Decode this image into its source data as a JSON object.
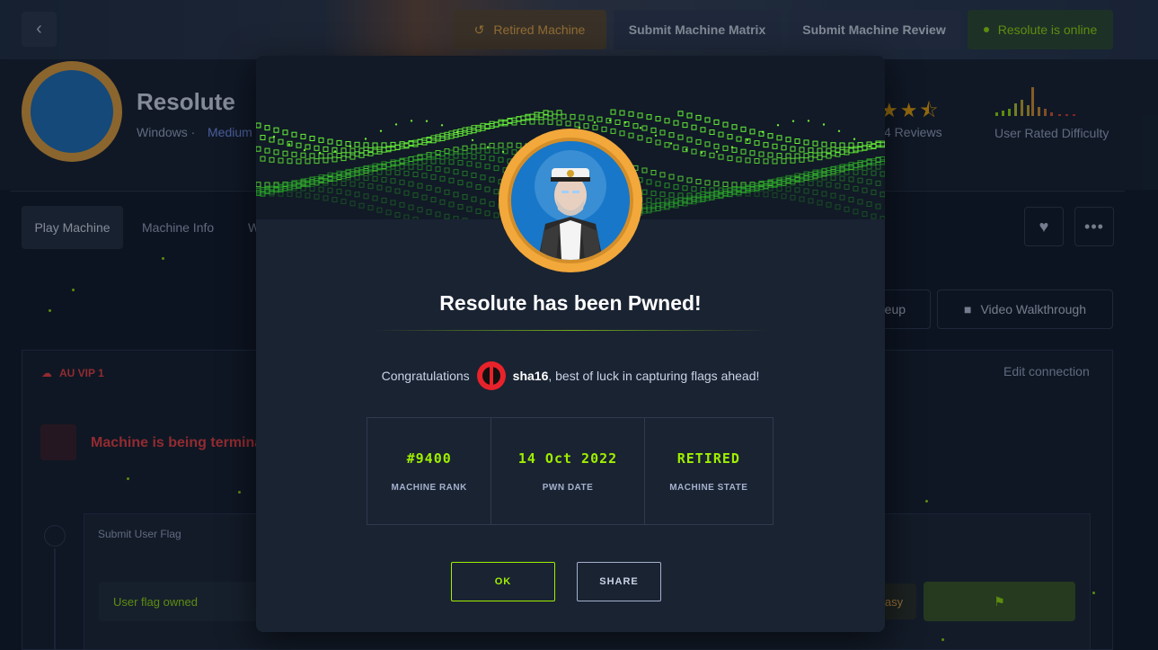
{
  "topbar": {
    "retired_label": "Retired Machine",
    "matrix_label": "Submit Machine Matrix",
    "review_label": "Submit Machine Review",
    "online_label": "Resolute is online"
  },
  "machine": {
    "name": "Resolute",
    "os": "Windows ·",
    "difficulty": "Medium",
    "reviews": "4 Reviews",
    "user_rated_difficulty": "User Rated Difficulty",
    "rating_stars": 4.5
  },
  "tabs": [
    {
      "label": "Play Machine"
    },
    {
      "label": "Machine Info"
    },
    {
      "label": "W"
    }
  ],
  "actions": {
    "writeup_label": "riteup",
    "video_label": "Video Walkthrough"
  },
  "panel": {
    "vip_label": "AU VIP 1",
    "edit_connection": "Edit connection",
    "terminating_text": "Machine is being termina",
    "submit_user_flag": "Submit User Flag",
    "user_flag_owned": "User flag owned",
    "easy_chip": "asy"
  },
  "modal": {
    "title": "Resolute has been Pwned!",
    "congrats_prefix": "Congratulations",
    "username": "sha16",
    "congrats_suffix": ", best of luck in capturing flags ahead!",
    "stats": [
      {
        "value": "#9400",
        "label": "MACHINE RANK"
      },
      {
        "value": "14 Oct 2022",
        "label": "PWN DATE"
      },
      {
        "value": "RETIRED",
        "label": "MACHINE STATE"
      }
    ],
    "ok_label": "OK",
    "share_label": "SHARE"
  },
  "colors": {
    "accent": "#9fef00",
    "orange": "#ffb545",
    "danger": "#ff3e3e",
    "background": "#0d1421",
    "modal_bg": "#1a2332"
  }
}
